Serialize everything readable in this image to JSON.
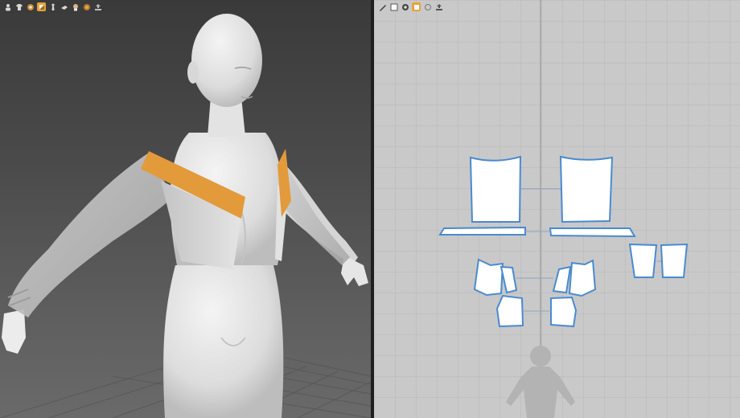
{
  "viewport_3d": {
    "toolbar": [
      {
        "icon": "avatar-display-icon"
      },
      {
        "icon": "garment-display-icon"
      },
      {
        "icon": "texture-display-icon"
      },
      {
        "icon": "shading-icon",
        "active": true
      },
      {
        "icon": "avatar-pose-icon"
      },
      {
        "icon": "camera-icon"
      },
      {
        "icon": "skin-icon"
      },
      {
        "icon": "render-icon"
      },
      {
        "icon": "export-icon"
      }
    ],
    "highlight_color": "#e39a3b"
  },
  "viewport_2d": {
    "toolbar": [
      {
        "icon": "transform-pattern-icon"
      },
      {
        "icon": "edit-pattern-icon"
      },
      {
        "icon": "texture-icon"
      },
      {
        "icon": "shading-icon",
        "active": true
      },
      {
        "icon": "pattern-view-icon"
      },
      {
        "icon": "export-icon"
      }
    ],
    "pattern_outline_color": "#4a8ad0",
    "grid_color": "#b4b4b4"
  }
}
